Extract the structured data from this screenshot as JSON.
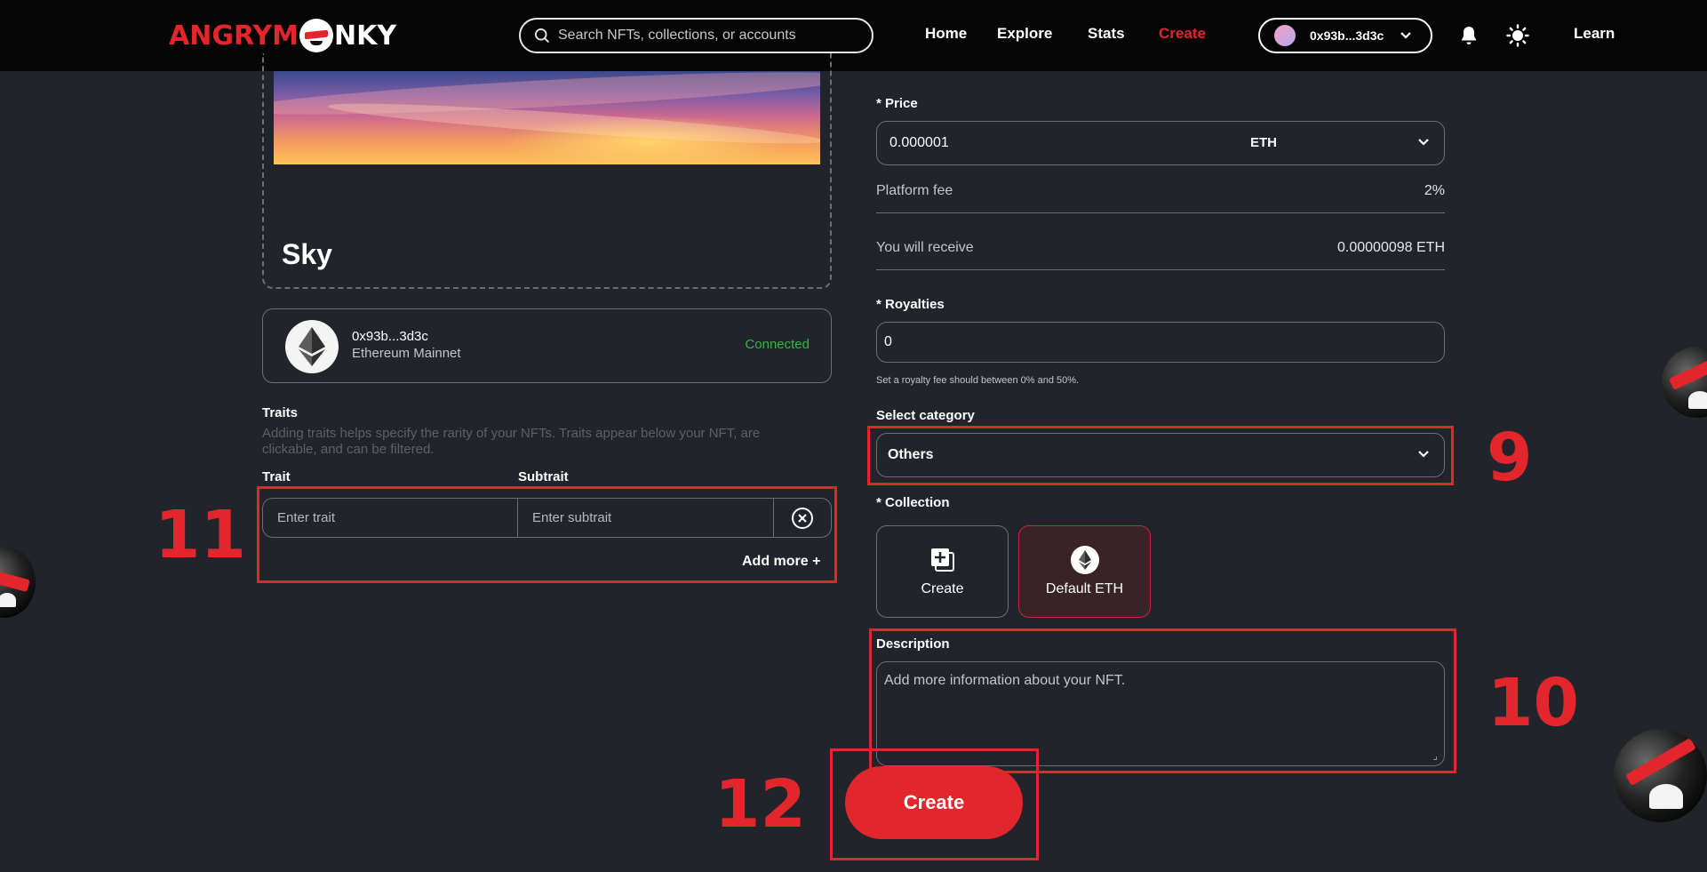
{
  "header": {
    "logo_text_red": "ANGRYM",
    "logo_text_white": "NKY",
    "search_placeholder": "Search NFTs, collections, or accounts",
    "nav": {
      "home": "Home",
      "explore": "Explore",
      "stats": "Stats",
      "create": "Create"
    },
    "wallet_address": "0x93b...3d3c",
    "learn": "Learn"
  },
  "preview": {
    "name": "Sky"
  },
  "wallet_card": {
    "address": "0x93b...3d3c",
    "network": "Ethereum Mainnet",
    "status": "Connected"
  },
  "traits": {
    "title": "Traits",
    "help": "Adding traits helps specify the rarity of your NFTs. Traits appear below your NFT, are clickable, and can be filtered.",
    "col_trait": "Trait",
    "col_subtrait": "Subtrait",
    "trait_placeholder": "Enter trait",
    "subtrait_placeholder": "Enter subtrait",
    "add_more": "Add more +"
  },
  "form": {
    "price_label": "* Price",
    "price_value": "0.000001",
    "price_currency": "ETH",
    "platform_fee_label": "Platform fee",
    "platform_fee_value": "2%",
    "receive_label": "You will receive",
    "receive_value": "0.00000098 ETH",
    "royalties_label": "* Royalties",
    "royalties_value": "0",
    "royalties_help": "Set a royalty fee should between 0% and 50%.",
    "category_label": "Select category",
    "category_value": "Others",
    "collection_label": "* Collection",
    "collection_options": [
      "Create",
      "Default ETH"
    ],
    "description_label": "Description",
    "description_placeholder": "Add more information about your NFT.",
    "submit": "Create"
  },
  "annotations": [
    "9",
    "10",
    "11",
    "12"
  ],
  "colors": {
    "accent": "#e3262c",
    "background": "#21252b",
    "header": "#050505",
    "connected": "#37b34a"
  }
}
